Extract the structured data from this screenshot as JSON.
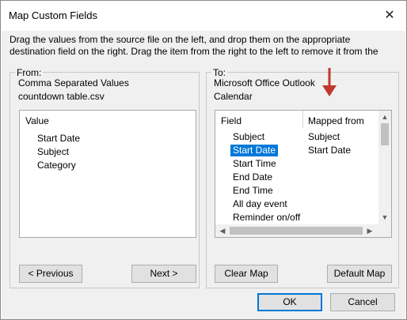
{
  "window": {
    "title": "Map Custom Fields",
    "close_icon": "close-icon"
  },
  "instructions": {
    "line1": "Drag the values from the source file on the left, and drop them on the appropriate",
    "line2": "destination field on the right.  Drag the item from the right to the left to remove it from the"
  },
  "from": {
    "caption": "From:",
    "source_type": "Comma Separated Values",
    "file_name": "countdown table.csv",
    "list_header": "Value",
    "items": [
      "Start Date",
      "Subject",
      "Category"
    ],
    "previous_label": "< Previous",
    "next_label": "Next >"
  },
  "to": {
    "caption": "To:",
    "target_app": "Microsoft Office Outlook",
    "target_folder": "Calendar",
    "col_field": "Field",
    "col_mapped": "Mapped from",
    "rows": [
      {
        "field": "Subject",
        "mapped": "Subject"
      },
      {
        "field": "Start Date",
        "mapped": "Start Date"
      },
      {
        "field": "Start Time",
        "mapped": ""
      },
      {
        "field": "End Date",
        "mapped": ""
      },
      {
        "field": "End Time",
        "mapped": ""
      },
      {
        "field": "All day event",
        "mapped": ""
      },
      {
        "field": "Reminder on/off",
        "mapped": ""
      }
    ],
    "selected_row": 1,
    "clear_map_label": "Clear Map",
    "default_map_label": "Default Map"
  },
  "footer": {
    "ok_label": "OK",
    "cancel_label": "Cancel"
  },
  "colors": {
    "selection": "#0078d7",
    "annotation_arrow": "#c0392b"
  }
}
